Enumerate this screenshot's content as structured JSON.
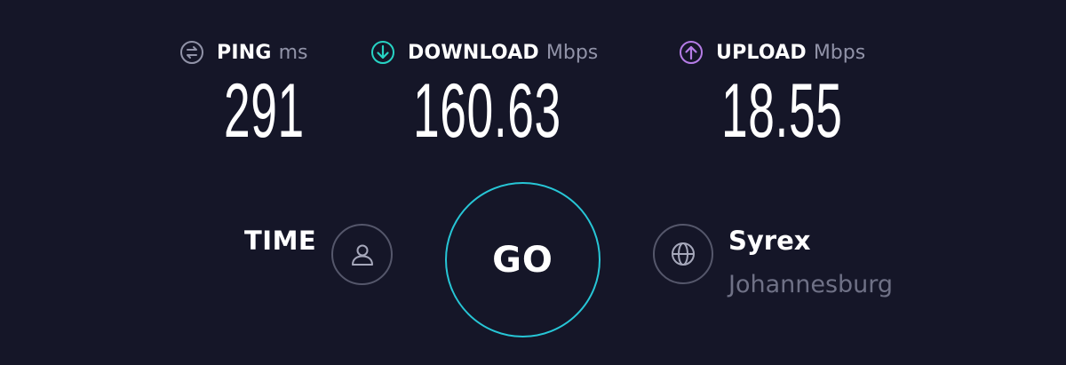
{
  "metrics": {
    "ping": {
      "label": "PING",
      "unit": "ms",
      "value": "291",
      "icon": "ping-icon",
      "icon_color": "#9193a8"
    },
    "download": {
      "label": "DOWNLOAD",
      "unit": "Mbps",
      "value": "160.63",
      "icon": "download-arrow-icon",
      "icon_color": "#27d3c4"
    },
    "upload": {
      "label": "UPLOAD",
      "unit": "Mbps",
      "value": "18.55",
      "icon": "upload-arrow-icon",
      "icon_color": "#b57ce6"
    }
  },
  "controls": {
    "time_label": "TIME",
    "go_label": "GO",
    "user_icon": "user-icon",
    "globe_icon": "globe-icon"
  },
  "server": {
    "name": "Syrex",
    "location": "Johannesburg"
  },
  "colors": {
    "background": "#151628",
    "go_ring": "#27c6d6",
    "muted_text": "#6f7186"
  }
}
